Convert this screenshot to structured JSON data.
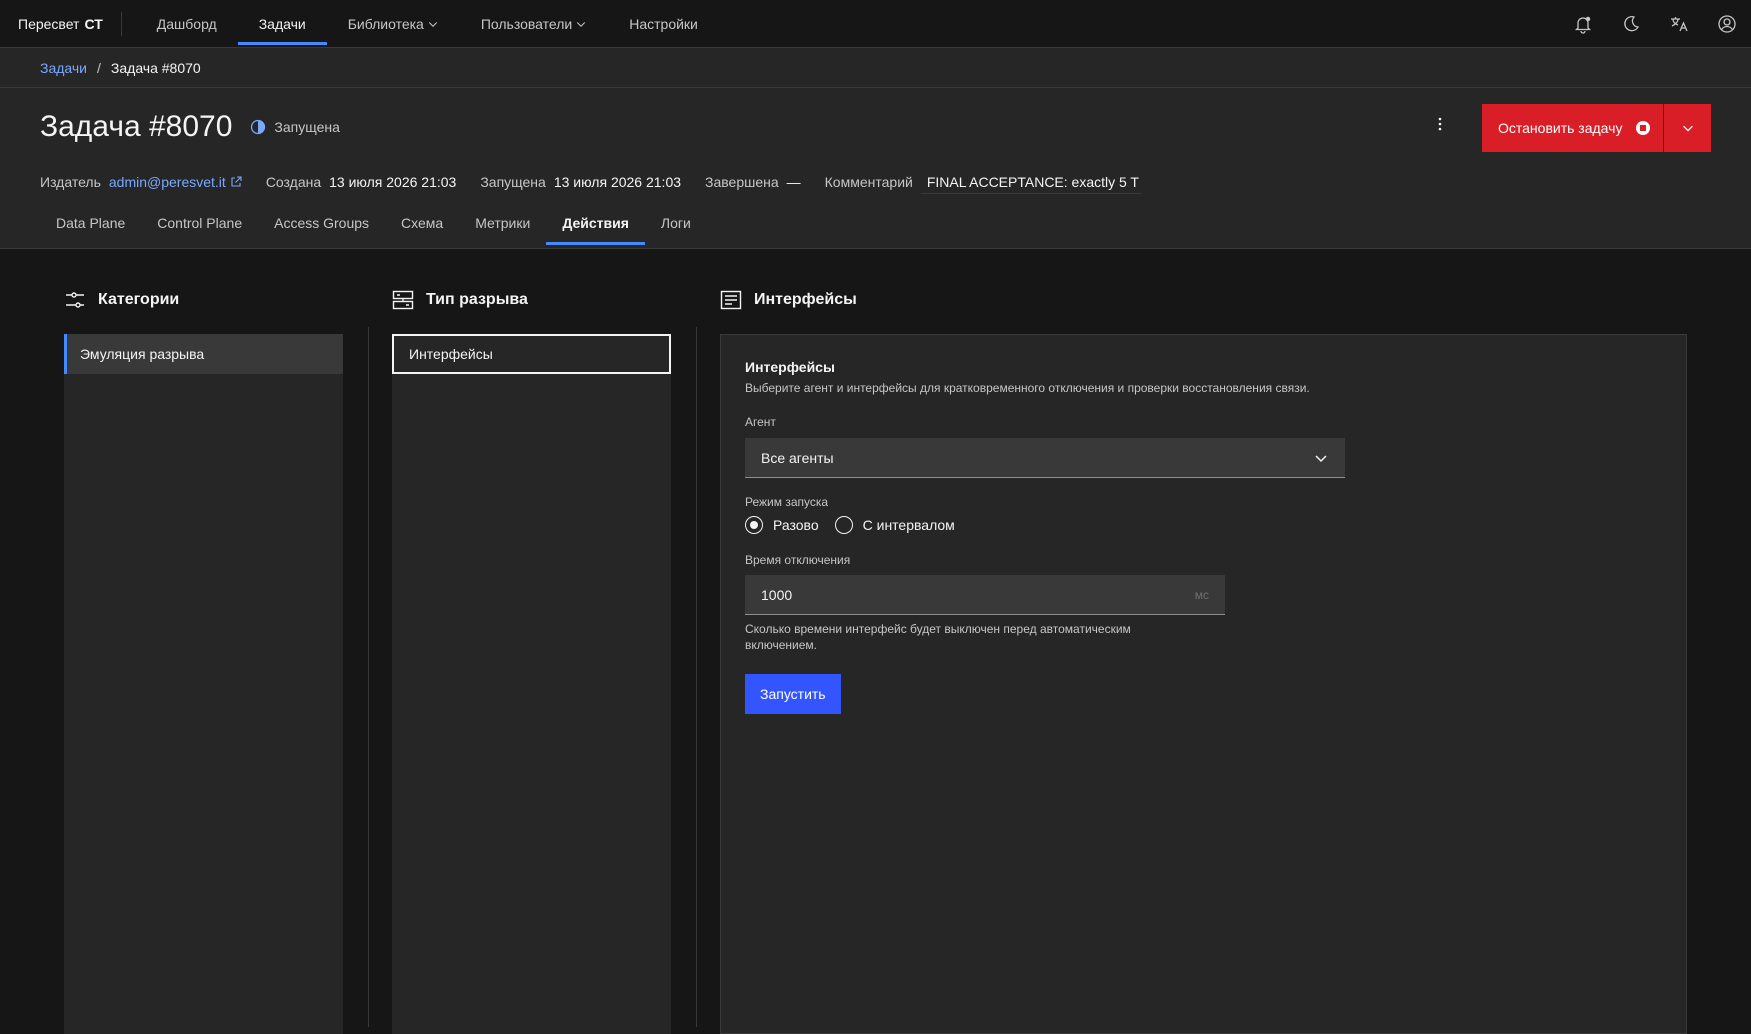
{
  "header": {
    "brand_name": "Пересвет",
    "brand_suffix": "СТ",
    "nav": [
      {
        "label": "Дашборд"
      },
      {
        "label": "Задачи"
      },
      {
        "label": "Библиотека"
      },
      {
        "label": "Пользователи"
      },
      {
        "label": "Настройки"
      }
    ],
    "active_nav": "Задачи",
    "action_icons": [
      "notification-icon",
      "moon-icon",
      "translate-icon",
      "user-avatar-icon"
    ]
  },
  "breadcrumb": {
    "parent": "Задачи",
    "separator": "/",
    "current": "Задача #8070"
  },
  "task": {
    "title": "Задача #8070",
    "status": "Запущена",
    "publisher_label": "Издатель",
    "publisher": "admin@peresvet.it",
    "created_label": "Создана",
    "created": "13 июля 2026 21:03",
    "started_label": "Запущена",
    "started": "13 июля 2026 21:03",
    "finished_label": "Завершена",
    "finished": "—",
    "comment_label": "Комментарий",
    "comment": "FINAL ACCEPTANCE: exactly 5 T",
    "stop_label": "Остановить задачу"
  },
  "tabs": [
    {
      "label": "Data Plane"
    },
    {
      "label": "Control Plane"
    },
    {
      "label": "Access Groups"
    },
    {
      "label": "Схема"
    },
    {
      "label": "Метрики"
    },
    {
      "label": "Действия"
    },
    {
      "label": "Логи"
    }
  ],
  "active_tab": "Действия",
  "categories": {
    "heading": "Категории",
    "items": [
      {
        "label": "Эмуляция разрыва"
      }
    ]
  },
  "break_type": {
    "heading": "Тип разрыва",
    "items": [
      {
        "label": "Интерфейсы"
      }
    ]
  },
  "interfaces": {
    "heading": "Интерфейсы",
    "form_title": "Интерфейсы",
    "form_desc": "Выберите агент и интерфейсы для кратковременного отключения и проверки восстановления связи.",
    "agent_label": "Агент",
    "agent_value": "Все агенты",
    "mode_label": "Режим запуска",
    "mode_once": "Разово",
    "mode_interval": "С интервалом",
    "mode_selected": "Разово",
    "downtime_label": "Время отключения",
    "downtime_value": "1000",
    "downtime_unit": "мс",
    "downtime_helper": "Сколько времени интерфейс будет выключен перед автоматическим включением.",
    "run_label": "Запустить"
  },
  "colors": {
    "accent": "#4589ff",
    "danger": "#da1e28",
    "primary_button": "#3355ff",
    "link": "#78a9ff"
  }
}
